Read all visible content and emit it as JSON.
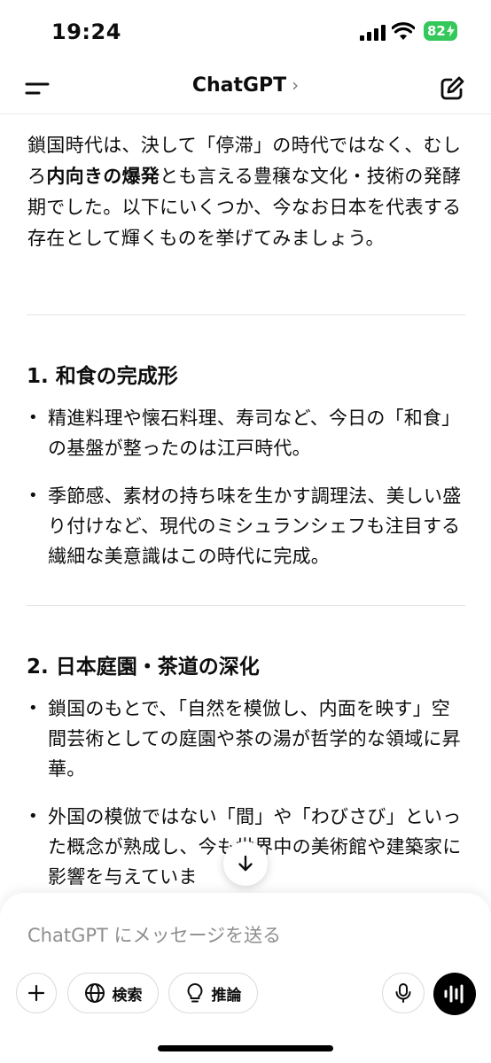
{
  "status_bar": {
    "time": "19:24",
    "battery": "82"
  },
  "nav": {
    "title": "ChatGPT",
    "chevron": "›"
  },
  "message": {
    "intro_part1": "鎖国時代は、決して「停滞」の時代ではなく、むしろ",
    "intro_bold": "内向きの爆発",
    "intro_part2": "とも言える豊穣な文化・技術の発酵期でした。以下にいくつか、今なお日本を代表する存在として輝くものを挙げてみましょう。",
    "sections": [
      {
        "heading": "1. 和食の完成形",
        "bullets": [
          "精進料理や懐石料理、寿司など、今日の「和食」の基盤が整ったのは江戸時代。",
          "季節感、素材の持ち味を生かす調理法、美しい盛り付けなど、現代のミシュランシェフも注目する繊細な美意識はこの時代に完成。"
        ]
      },
      {
        "heading": "2. 日本庭園・茶道の深化",
        "bullets": [
          "鎖国のもとで、「自然を模倣し、内面を映す」空間芸術としての庭園や茶の湯が哲学的な領域に昇華。",
          "外国の模倣ではない「間」や「わびさび」といった概念が熟成し、今も世界中の美術館や建築家に影響を与えていま"
        ]
      }
    ]
  },
  "composer": {
    "placeholder": "ChatGPT にメッセージを送る",
    "search_label": "検索",
    "reason_label": "推論"
  },
  "icons": {
    "menu": "menu-icon",
    "edit": "new-chat-icon",
    "scroll": "arrow-down-icon",
    "plus": "plus-icon",
    "globe": "globe-icon",
    "bulb": "lightbulb-icon",
    "mic": "microphone-icon",
    "voice": "voice-mode-icon"
  },
  "colors": {
    "battery": "#34c759",
    "text": "#0d0d0d",
    "placeholder": "#8e8e8e"
  }
}
